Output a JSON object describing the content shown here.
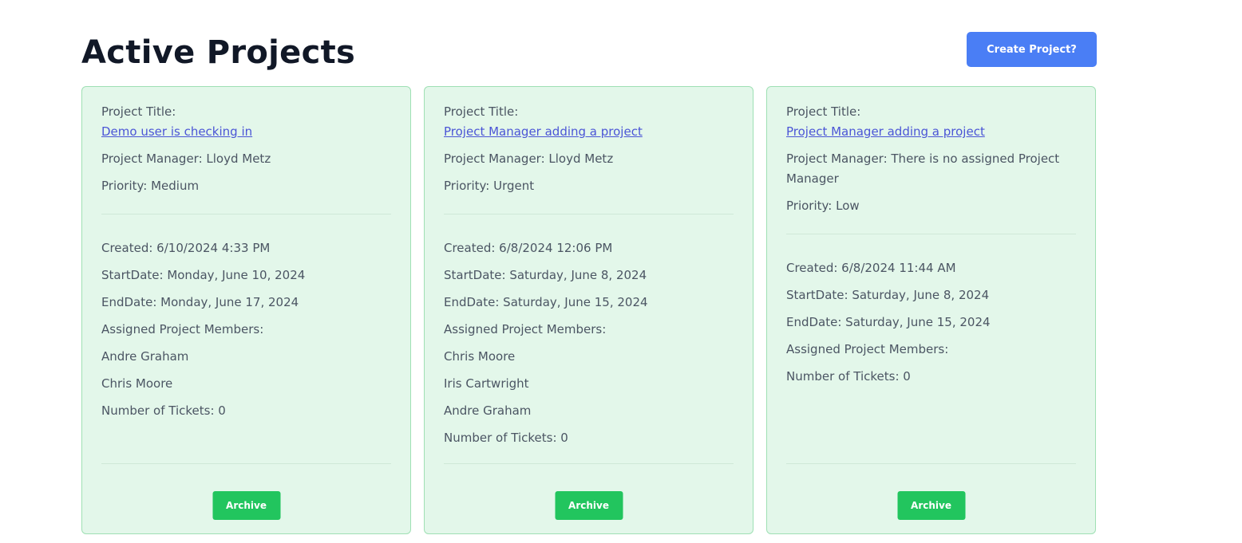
{
  "header": {
    "title": "Active Projects",
    "create_button_label": "Create Project?"
  },
  "colors": {
    "accent_blue": "#4a7ef5",
    "card_background": "#e3f7ea",
    "card_border": "#9fe0b4",
    "archive_green": "#22c55e",
    "link": "#4b55d6"
  },
  "projects": [
    {
      "title_label": "Project Title:",
      "title": "Demo user is checking in",
      "manager": "Project Manager: Lloyd Metz",
      "priority": "Priority: Medium",
      "created": "Created: 6/10/2024 4:33 PM",
      "start_date": "StartDate: Monday, June 10, 2024",
      "end_date": "EndDate: Monday, June 17, 2024",
      "members_label": "Assigned Project Members:",
      "members": [
        "Andre Graham",
        "Chris Moore"
      ],
      "tickets": "Number of Tickets: 0",
      "archive_label": "Archive"
    },
    {
      "title_label": "Project Title:",
      "title": "Project Manager adding a project",
      "manager": "Project Manager: Lloyd Metz",
      "priority": "Priority: Urgent",
      "created": "Created: 6/8/2024 12:06 PM",
      "start_date": "StartDate: Saturday, June 8, 2024",
      "end_date": "EndDate: Saturday, June 15, 2024",
      "members_label": "Assigned Project Members:",
      "members": [
        "Chris Moore",
        "Iris Cartwright",
        "Andre Graham"
      ],
      "tickets": "Number of Tickets: 0",
      "archive_label": "Archive"
    },
    {
      "title_label": "Project Title:",
      "title": "Project Manager adding a project",
      "manager": "Project Manager: There is no assigned Project Manager",
      "priority": "Priority: Low",
      "created": "Created: 6/8/2024 11:44 AM",
      "start_date": "StartDate: Saturday, June 8, 2024",
      "end_date": "EndDate: Saturday, June 15, 2024",
      "members_label": "Assigned Project Members:",
      "members": [],
      "tickets": "Number of Tickets: 0",
      "archive_label": "Archive"
    }
  ]
}
